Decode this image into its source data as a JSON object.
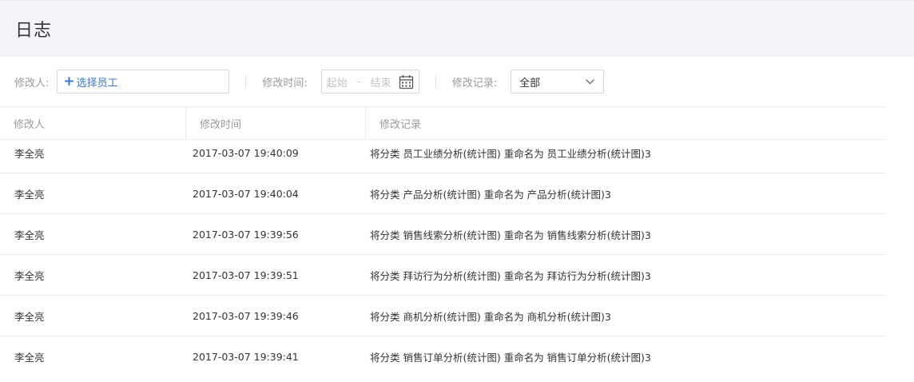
{
  "header": {
    "title": "日志"
  },
  "filters": {
    "modifier_label": "修改人:",
    "select_employee": "选择员工",
    "time_label": "修改时间:",
    "start_placeholder": "起始",
    "range_dash": "-",
    "end_placeholder": "结束",
    "record_label": "修改记录:",
    "record_value": "全部"
  },
  "table": {
    "columns": [
      "修改人",
      "修改时间",
      "修改记录"
    ],
    "rows": [
      {
        "user": "李全亮",
        "time": "2017-03-07 19:40:09",
        "record": "将分类 员工业绩分析(统计图) 重命名为 员工业绩分析(统计图)3"
      },
      {
        "user": "李全亮",
        "time": "2017-03-07 19:40:04",
        "record": "将分类 产品分析(统计图) 重命名为 产品分析(统计图)3"
      },
      {
        "user": "李全亮",
        "time": "2017-03-07 19:39:56",
        "record": "将分类 销售线索分析(统计图) 重命名为 销售线索分析(统计图)3"
      },
      {
        "user": "李全亮",
        "time": "2017-03-07 19:39:51",
        "record": "将分类 拜访行为分析(统计图) 重命名为 拜访行为分析(统计图)3"
      },
      {
        "user": "李全亮",
        "time": "2017-03-07 19:39:46",
        "record": "将分类 商机分析(统计图) 重命名为 商机分析(统计图)3"
      },
      {
        "user": "李全亮",
        "time": "2017-03-07 19:39:41",
        "record": "将分类 销售订单分析(统计图) 重命名为 销售订单分析(统计图)3"
      }
    ]
  },
  "colors": {
    "accent": "#3a78d6",
    "header_bg": "#f3f4f8",
    "border": "#ebebeb"
  }
}
